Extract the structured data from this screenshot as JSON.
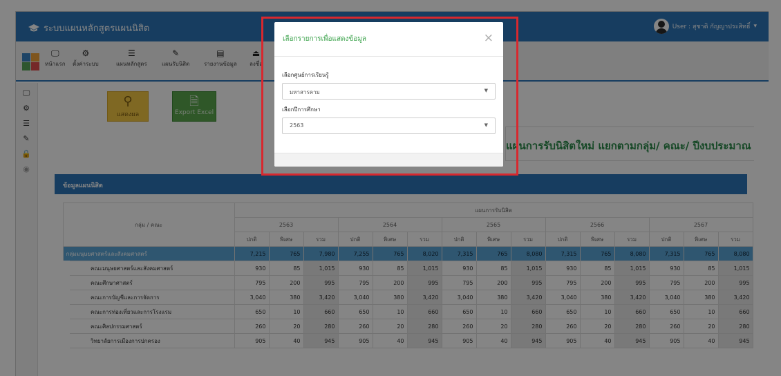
{
  "app": {
    "title": "ระบบแผนหลักสูตรแผนนิสิต",
    "user": "User : สุชาติ กัญญาประสิทธิ์"
  },
  "toolbar": [
    {
      "label": "หน้าแรก",
      "icon": "monitor-icon"
    },
    {
      "label": "ตั้งค่าระบบ",
      "icon": "gears-icon"
    },
    {
      "label": "แผนหลักสูตร",
      "icon": "list-icon"
    },
    {
      "label": "แผนรับนิสิต",
      "icon": "edit-icon"
    },
    {
      "label": "รายงานข้อมูล",
      "icon": "report-icon"
    },
    {
      "label": "ลงชื่อ",
      "icon": "signout-icon"
    }
  ],
  "actions": {
    "show": "แสดงผล",
    "export": "Export Excel"
  },
  "report_title": "แผนการรับนิสิตใหม่ แยกตามกลุ่ม/ คณะ/ ปีงบประมาณ",
  "panel": {
    "title": "ข้อมูลแผนนิสิต"
  },
  "table": {
    "group_header": "กลุ่ม / คณะ",
    "plan_header": "แผนการรับนิสิต",
    "years": [
      "2563",
      "2564",
      "2565",
      "2566",
      "2567"
    ],
    "sub_headers": [
      "ปกติ",
      "พิเศษ",
      "รวม"
    ],
    "rows": [
      {
        "name": "กลุ่มมนุษยศาสตร์และสังคมศาสตร์",
        "group": true,
        "values": [
          "7,215",
          "765",
          "7,980",
          "7,255",
          "765",
          "8,020",
          "7,315",
          "765",
          "8,080",
          "7,315",
          "765",
          "8,080",
          "7,315",
          "765",
          "8,080"
        ]
      },
      {
        "name": "คณะมนุษยศาสตร์และสังคมศาสตร์",
        "values": [
          "930",
          "85",
          "1,015",
          "930",
          "85",
          "1,015",
          "930",
          "85",
          "1,015",
          "930",
          "85",
          "1,015",
          "930",
          "85",
          "1,015"
        ]
      },
      {
        "name": "คณะศึกษาศาสตร์",
        "values": [
          "795",
          "200",
          "995",
          "795",
          "200",
          "995",
          "795",
          "200",
          "995",
          "795",
          "200",
          "995",
          "795",
          "200",
          "995"
        ]
      },
      {
        "name": "คณะการบัญชีและการจัดการ",
        "values": [
          "3,040",
          "380",
          "3,420",
          "3,040",
          "380",
          "3,420",
          "3,040",
          "380",
          "3,420",
          "3,040",
          "380",
          "3,420",
          "3,040",
          "380",
          "3,420"
        ]
      },
      {
        "name": "คณะการท่องเที่ยวและการโรงแรม",
        "values": [
          "650",
          "10",
          "660",
          "650",
          "10",
          "660",
          "650",
          "10",
          "660",
          "650",
          "10",
          "660",
          "650",
          "10",
          "660"
        ]
      },
      {
        "name": "คณะศิลปกรรมศาสตร์",
        "values": [
          "260",
          "20",
          "280",
          "260",
          "20",
          "280",
          "260",
          "20",
          "280",
          "260",
          "20",
          "280",
          "260",
          "20",
          "280"
        ]
      },
      {
        "name": "วิทยาลัยการเมืองการปกครอง",
        "values": [
          "905",
          "40",
          "945",
          "905",
          "40",
          "945",
          "905",
          "40",
          "945",
          "905",
          "40",
          "945",
          "905",
          "40",
          "945"
        ]
      }
    ]
  },
  "modal": {
    "title": "เลือกรายการเพื่อแสดงข้อมูล",
    "close": "×",
    "campus_label": "เลือกศูนย์การเรียนรู้",
    "campus_value": "มหาสารคาม",
    "year_label": "เลือกปีการศึกษา",
    "year_value": "2563",
    "highlight_color": "#d8282e"
  }
}
